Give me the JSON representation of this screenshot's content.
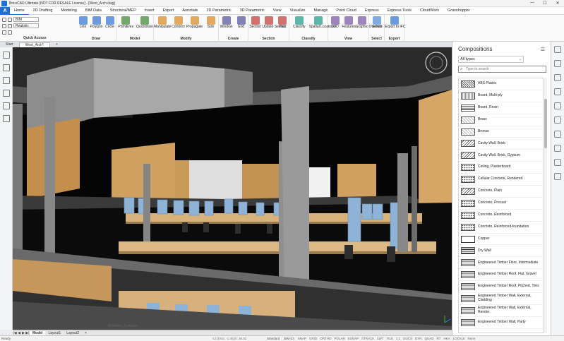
{
  "window": {
    "title": "BricsCAD Ultimate [NOT FOR RESALE License] - [West_Arch.dwg]",
    "controls": [
      "—",
      "☐",
      "✕"
    ]
  },
  "menu": {
    "logo": "A",
    "tabs": [
      "Home",
      "2D Drafting",
      "Modeling",
      "BIM Data",
      "Structural/MEP",
      "Insert",
      "Export",
      "Annotate",
      "2D Parametric",
      "3D Parametric",
      "View",
      "Visualize",
      "Manage",
      "Point Cloud",
      "Express",
      "Express Tools",
      "CloudWorx",
      "Grasshopper"
    ],
    "active": 0
  },
  "quick_access": {
    "layer": "BIM",
    "visual_style": "Realistic",
    "label": "Quick Access"
  },
  "ribbon": {
    "draw": {
      "label": "Draw",
      "buttons": [
        "Line",
        "Polygon",
        "Circle"
      ]
    },
    "model": {
      "label": "Model",
      "buttons": [
        "Primitives",
        "Quickdraw"
      ]
    },
    "modify": {
      "label": "Modify",
      "buttons": [
        "Manipulate",
        "Connect",
        "Propagate",
        "Size"
      ]
    },
    "create": {
      "label": "Create",
      "buttons": [
        "Window",
        "Grid"
      ]
    },
    "section": {
      "label": "Section",
      "buttons": [
        "Section",
        "Update Section",
        "Plan"
      ]
    },
    "classify": {
      "label": "Classify",
      "buttons": [
        "Classify",
        "Spatial Locations"
      ]
    },
    "view": {
      "label": "View",
      "buttons": [
        "LOD",
        "Features",
        "Graphic Override"
      ]
    },
    "select": {
      "label": "Select",
      "buttons": [
        "Select"
      ]
    },
    "export": {
      "label": "Export",
      "buttons": [
        "Export to IFC"
      ]
    }
  },
  "doc_tabs": [
    "Start",
    "West_Arch*",
    "+"
  ],
  "layout_tabs": {
    "nav": [
      "|◀",
      "◀",
      "▶",
      "▶|"
    ],
    "tabs": [
      "Model",
      "Layout1",
      "Layout2",
      "+"
    ]
  },
  "status": {
    "ready": "Ready",
    "coords": "-13.0043, -1.4620, 36.02",
    "standard": "Standard",
    "bim": "BIM-23",
    "toggles": [
      "SNAP",
      "GRID",
      "ORTHO",
      "POLAR",
      "ESNAP",
      "STRACK",
      "LWT",
      "TILE",
      "1:1",
      "DUCS",
      "DYN",
      "QUAD",
      "RT",
      "HKA",
      "LOCKUI",
      "None"
    ]
  },
  "panel": {
    "title": "Compositions",
    "filter": "All types",
    "search_placeholder": "Type to search",
    "items": [
      {
        "name": "ABS Plastic",
        "pattern": "s1"
      },
      {
        "name": "Board, Multi-ply",
        "pattern": "s2"
      },
      {
        "name": "Board, Resin",
        "pattern": "s9"
      },
      {
        "name": "Brass",
        "pattern": "s3"
      },
      {
        "name": "Bronze",
        "pattern": "s3"
      },
      {
        "name": "Cavity Wall, Brick",
        "pattern": "s4"
      },
      {
        "name": "Cavity Wall, Brick, Gypsum",
        "pattern": "s4"
      },
      {
        "name": "Ceiling, Plasterboard",
        "pattern": "s6"
      },
      {
        "name": "Cellular Concrete, Rendered",
        "pattern": "s6"
      },
      {
        "name": "Concrete, Plain",
        "pattern": "s4"
      },
      {
        "name": "Concrete, Precast",
        "pattern": "s6"
      },
      {
        "name": "Concrete, Reinforced",
        "pattern": "s6"
      },
      {
        "name": "Concrete, Reinforced-foundation",
        "pattern": "s6"
      },
      {
        "name": "Copper",
        "pattern": "s8"
      },
      {
        "name": "Dry Wall",
        "pattern": "s7"
      },
      {
        "name": "Engineered Timber Floor, Intermediate",
        "pattern": "s5"
      },
      {
        "name": "Engineered Timber Roof, Flat, Gravel",
        "pattern": "s5"
      },
      {
        "name": "Engineered Timber Roof, Pitched, Tiles",
        "pattern": "s5"
      },
      {
        "name": "Engineered Timber Wall, External, Cladding",
        "pattern": "s5"
      },
      {
        "name": "Engineered Timber Wall, External, Render",
        "pattern": "s5"
      },
      {
        "name": "Engineered Timber Wall, Party",
        "pattern": "s5"
      }
    ]
  },
  "viewport_hint": "BxSelect_Dynamic",
  "colors": {
    "accent": "#1f6fd5",
    "viewport_bg": "#030303",
    "wood": "#c99a58",
    "glass": "#8fb3d6",
    "concrete": "#8f8f8f"
  }
}
